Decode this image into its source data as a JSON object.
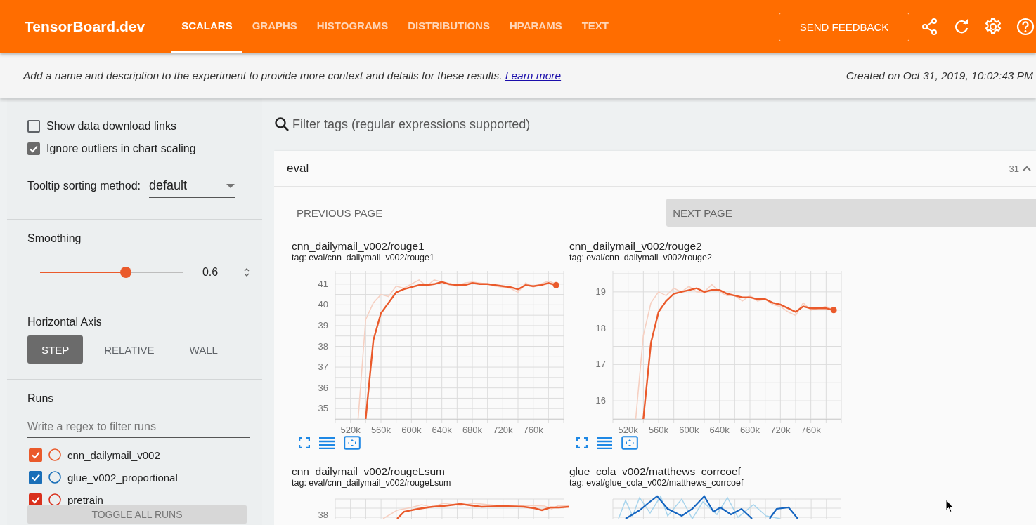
{
  "header": {
    "logo": "TensorBoard.dev",
    "tabs": [
      {
        "label": "SCALARS",
        "selected": true
      },
      {
        "label": "GRAPHS",
        "selected": false
      },
      {
        "label": "HISTOGRAMS",
        "selected": false
      },
      {
        "label": "DISTRIBUTIONS",
        "selected": false
      },
      {
        "label": "HPARAMS",
        "selected": false
      },
      {
        "label": "TEXT",
        "selected": false
      }
    ],
    "feedback_button": "SEND FEEDBACK"
  },
  "info_bar": {
    "text": "Add a name and description to the experiment to provide more context and details for these results.",
    "link": "Learn more",
    "created": "Created on Oct 31, 2019, 10:02:43 PM"
  },
  "sidebar": {
    "options": [
      {
        "label": "Show data download links",
        "checked": false
      },
      {
        "label": "Ignore outliers in chart scaling",
        "checked": true
      }
    ],
    "tooltip_sorting": {
      "label": "Tooltip sorting method:",
      "value": "default"
    },
    "smoothing": {
      "label": "Smoothing",
      "level": 0.6,
      "value": "0.6"
    },
    "horizontal_axis": {
      "label": "Horizontal Axis",
      "options": [
        {
          "label": "STEP",
          "selected": true
        },
        {
          "label": "RELATIVE",
          "selected": false
        },
        {
          "label": "WALL",
          "selected": false
        }
      ]
    },
    "runs": {
      "label": "Runs",
      "placeholder": "Write a regex to filter runs",
      "items": [
        {
          "name": "cnn_dailymail_v002",
          "checked": true,
          "color": "#ea5a2b"
        },
        {
          "name": "glue_v002_proportional",
          "checked": true,
          "color": "#1a6fb8"
        },
        {
          "name": "pretrain",
          "checked": true,
          "color": "#d9301c"
        }
      ]
    },
    "toggle_button": "TOGGLE ALL RUNS"
  },
  "main": {
    "filter": {
      "placeholder": "Filter tags (regular expressions supported)"
    },
    "section": {
      "title": "eval",
      "count": "31",
      "expanded": true
    },
    "pagination": {
      "previous": "PREVIOUS PAGE",
      "next": "NEXT PAGE"
    },
    "charts": [
      {
        "title": "cnn_dailymail_v002/rouge1",
        "tag": "tag: eval/cnn_dailymail_v002/rouge1",
        "chart_data": {
          "type": "line",
          "x": [
            530000,
            540000,
            550000,
            560000,
            570000,
            580000,
            590000,
            600000,
            610000,
            620000,
            630000,
            640000,
            650000,
            660000,
            670000,
            680000,
            690000,
            700000,
            710000,
            720000,
            730000,
            740000,
            750000,
            760000,
            770000,
            780000,
            790000
          ],
          "series": [
            {
              "color": "#f6d0c2",
              "values": [
                34.5,
                39.3,
                40.1,
                40.5,
                40.4,
                40.9,
                40.8,
                41.0,
                41.2,
                40.9,
                41.2,
                41.1,
                40.95,
                40.9,
                41.05,
                41.1,
                null,
                41.0,
                40.9,
                40.85,
                40.8,
                40.6,
                41.05,
                40.85,
                41.0,
                41.15,
                41.0
              ]
            },
            {
              "color": "#ea5a2b",
              "values": [
                null,
                34.5,
                38.3,
                39.6,
                40.1,
                40.6,
                40.75,
                40.85,
                40.95,
                40.95,
                41.0,
                41.1,
                41.0,
                40.95,
                40.95,
                41.05,
                41.0,
                41.0,
                40.95,
                40.9,
                40.85,
                40.75,
                40.95,
                40.9,
                40.95,
                41.05,
                40.95
              ]
            }
          ],
          "xlim": [
            500000,
            800000
          ],
          "ylim": [
            34.5,
            41.5
          ],
          "grid": true,
          "xticks": [
            {
              "value": 520000,
              "label": "520k"
            },
            {
              "value": 560000,
              "label": "560k"
            },
            {
              "value": 600000,
              "label": "600k"
            },
            {
              "value": 640000,
              "label": "640k"
            },
            {
              "value": 680000,
              "label": "680k"
            },
            {
              "value": 720000,
              "label": "720k"
            },
            {
              "value": 760000,
              "label": "760k"
            }
          ],
          "yticks": [
            35,
            36,
            37,
            38,
            39,
            40,
            41
          ]
        }
      },
      {
        "title": "cnn_dailymail_v002/rouge2",
        "tag": "tag: eval/cnn_dailymail_v002/rouge2",
        "chart_data": {
          "type": "line",
          "x": [
            530000,
            540000,
            550000,
            560000,
            570000,
            580000,
            590000,
            600000,
            610000,
            620000,
            630000,
            640000,
            650000,
            660000,
            670000,
            680000,
            690000,
            700000,
            710000,
            720000,
            730000,
            740000,
            750000,
            760000,
            770000,
            780000,
            790000
          ],
          "series": [
            {
              "color": "#f6d0c2",
              "values": [
                15.5,
                17.8,
                18.7,
                19.0,
                18.9,
                19.1,
                19.0,
                19.15,
                19.0,
                19.0,
                19.2,
                19.0,
                18.9,
                18.9,
                18.75,
                18.9,
                18.75,
                18.8,
                18.65,
                18.6,
                18.45,
                18.35,
                18.7,
                18.5,
                18.55,
                18.6,
                18.5
              ]
            },
            {
              "color": "#ea5a2b",
              "values": [
                null,
                15.5,
                17.6,
                18.45,
                18.75,
                18.95,
                19.0,
                19.05,
                19.1,
                19.0,
                19.05,
                19.05,
                18.95,
                18.9,
                18.85,
                18.85,
                18.8,
                18.8,
                18.7,
                18.65,
                18.55,
                18.45,
                18.6,
                18.55,
                18.55,
                18.55,
                18.5
              ]
            }
          ],
          "xlim": [
            500000,
            800000
          ],
          "ylim": [
            15.5,
            19.5
          ],
          "grid": true,
          "xticks": [
            {
              "value": 520000,
              "label": "520k"
            },
            {
              "value": 560000,
              "label": "560k"
            },
            {
              "value": 600000,
              "label": "600k"
            },
            {
              "value": 640000,
              "label": "640k"
            },
            {
              "value": 680000,
              "label": "680k"
            },
            {
              "value": 720000,
              "label": "720k"
            },
            {
              "value": 760000,
              "label": "760k"
            }
          ],
          "yticks": [
            16,
            17,
            18,
            19
          ]
        }
      }
    ],
    "partial_charts": [
      {
        "title": "cnn_dailymail_v002/rougeLsum",
        "tag": "tag: eval/cnn_dailymail_v002/rougeLsum",
        "kind": "single-run",
        "tick_label": "38"
      },
      {
        "title": "glue_cola_v002/matthews_corrcoef",
        "tag": "tag: eval/glue_cola_v002/matthews_corrcoef",
        "kind": "multi-run"
      }
    ]
  }
}
